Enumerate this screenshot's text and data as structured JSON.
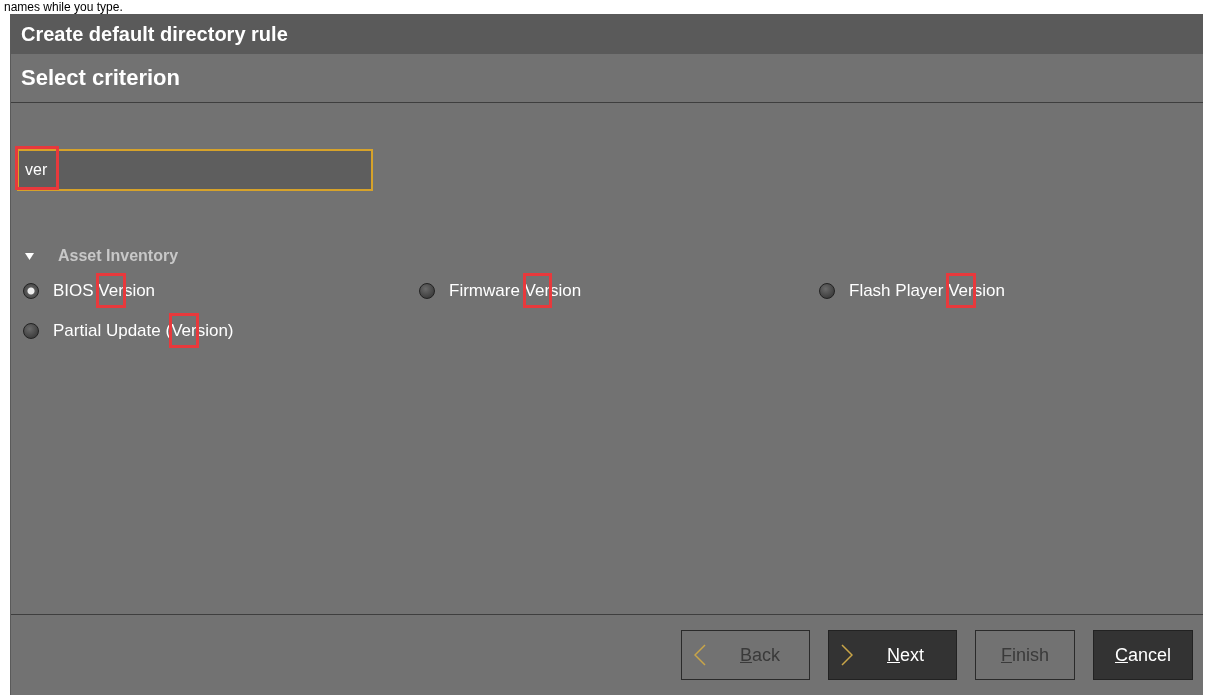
{
  "caption": "names while you type.",
  "window": {
    "title": "Create default directory rule"
  },
  "step": {
    "title": "Select criterion"
  },
  "search": {
    "value": "ver",
    "highlighted": true
  },
  "groups": [
    {
      "label": "Asset Inventory",
      "expanded": true,
      "options": [
        {
          "label": "BIOS Version",
          "selected": true,
          "highlighted": true
        },
        {
          "label": "Firmware Version",
          "selected": false,
          "highlighted": true
        },
        {
          "label": "Flash Player Version",
          "selected": false,
          "highlighted": true
        },
        {
          "label": "Partial Update (Version)",
          "selected": false,
          "highlighted": true
        }
      ]
    }
  ],
  "buttons": [
    {
      "kind": "back",
      "label": "Back",
      "mnemonic": true,
      "disabled": true
    },
    {
      "kind": "next",
      "label": "Next",
      "mnemonic": true,
      "disabled": false
    },
    {
      "kind": "plain",
      "label": "Finish",
      "mnemonic": true,
      "disabled": true
    },
    {
      "kind": "plain",
      "label": "Cancel",
      "mnemonic": true,
      "disabled": false
    }
  ]
}
